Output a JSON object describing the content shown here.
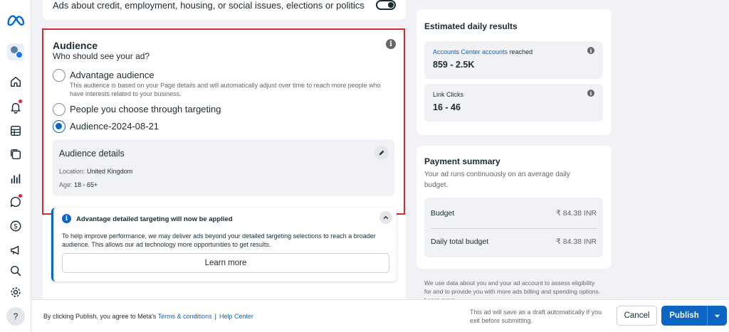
{
  "top_setting": {
    "label": "Ads about credit, employment, housing, or social issues, elections or politics"
  },
  "audience": {
    "title": "Audience",
    "subtitle": "Who should see your ad?",
    "options": [
      {
        "label": "Advantage audience",
        "description": "This audience is based on your Page details and will automatically adjust over time to reach more people who have interests related to your business.",
        "selected": false
      },
      {
        "label": "People you choose through targeting",
        "selected": false
      },
      {
        "label": "Audience-2024-08-21",
        "selected": true
      }
    ],
    "details": {
      "title": "Audience details",
      "location_label": "Location:",
      "location_value": "United Kingdom",
      "age_label": "Age:",
      "age_value": "18 - 65+"
    }
  },
  "notice": {
    "title": "Advantage detailed targeting will now be applied",
    "body": "To help improve performance, we may deliver ads beyond your detailed targeting selections to reach a broader audience. This allows our ad technology more opportunities to get results.",
    "button": "Learn more"
  },
  "estimated": {
    "title": "Estimated daily results",
    "reach_link": "Accounts Center accounts",
    "reach_suffix": " reached",
    "reach_value": "859 - 2.5K",
    "clicks_label": "Link Clicks",
    "clicks_value": "16 - 46"
  },
  "payment": {
    "title": "Payment summary",
    "subtitle": "Your ad runs continuously on an average daily budget.",
    "rows": [
      {
        "label": "Budget",
        "value": "₹ 84.38 INR"
      },
      {
        "label": "Daily total budget",
        "value": "₹ 84.38 INR"
      }
    ],
    "footnote": "We use data about you and your ad account to assess eligibility for and to provide you with more ads billing and spending options. Learn more"
  },
  "bottom": {
    "legal_prefix": "By clicking Publish, you agree to Meta's ",
    "terms": "Terms & conditions",
    "separator": "|",
    "help_center": "Help Center",
    "save_note": "This ad will save as a draft automatically if you exit before submitting.",
    "cancel": "Cancel",
    "publish": "Publish",
    "help": "?"
  },
  "colors": {
    "accent": "#0a66c2",
    "highlight": "#d6262e",
    "alert": "#e41e3f"
  },
  "icons": [
    "meta-logo-icon",
    "account-avatar-icon",
    "home-icon",
    "notifications-icon",
    "table-icon",
    "layers-icon",
    "chart-icon",
    "chat-icon",
    "billing-icon",
    "megaphone-icon",
    "search-icon",
    "settings-icon",
    "help-icon"
  ]
}
